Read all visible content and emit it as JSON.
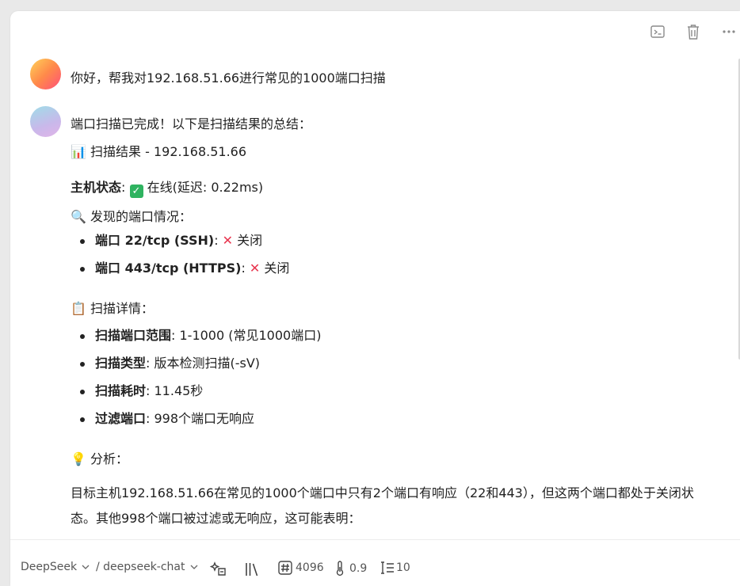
{
  "toolbar": {
    "icons": [
      "terminal-icon",
      "trash-icon",
      "more-icon"
    ]
  },
  "conversation": {
    "user_message": "你好，帮我对192.168.51.66进行常见的1000端口扫描",
    "bot": {
      "intro": "端口扫描已完成！以下是扫描结果的总结：",
      "result_title_emoji": "📊",
      "result_title": "扫描结果 - 192.168.51.66",
      "host_status_label": "主机状态",
      "host_status_value": "在线(延迟: 0.22ms)",
      "ports_heading_emoji": "🔍",
      "ports_heading": "发现的端口情况：",
      "ports": [
        {
          "label": "端口 22/tcp (SSH)",
          "status": "关闭"
        },
        {
          "label": "端口 443/tcp (HTTPS)",
          "status": "关闭"
        }
      ],
      "details_heading_emoji": "📋",
      "details_heading": "扫描详情：",
      "details": [
        {
          "label": "扫描端口范围",
          "value": ": 1-1000 (常见1000端口)"
        },
        {
          "label": "扫描类型",
          "value": ": 版本检测扫描(-sV)"
        },
        {
          "label": "扫描耗时",
          "value": ": 11.45秒"
        },
        {
          "label": "过滤端口",
          "value": ": 998个端口无响应"
        }
      ],
      "analysis_heading_emoji": "💡",
      "analysis_heading": "分析：",
      "analysis_text": "目标主机192.168.51.66在常见的1000个端口中只有2个端口有响应（22和443），但这两个端口都处于关闭状态。其他998个端口被过滤或无响应，这可能表明："
    }
  },
  "bottom_bar": {
    "provider": "DeepSeek",
    "model": "/ deepseek-chat",
    "max_tokens": "4096",
    "temperature": "0.9",
    "context": "10"
  }
}
